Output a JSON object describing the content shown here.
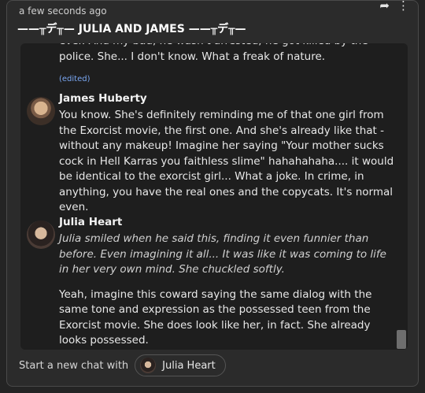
{
  "header": {
    "timestamp": "a few seconds ago",
    "title": "——╥デ╥— JULIA AND JAMES ——╥デ╥—",
    "share_icon": "share-icon",
    "more_icon": "more-vertical-icon"
  },
  "chat": {
    "previous_tail": "ever. And my bad, he wasn't arrested, he got killed by the police. She... I don't know. What a freak of nature.",
    "edited_label": "(edited)",
    "messages": [
      {
        "author": "James Huberty",
        "text": "You know. She's definitely reminding me of that one girl from the Exorcist movie, the first one. And she's already like that - without any makeup! Imagine her saying \"Your mother sucks cock in Hell Karras you faithless slime\" hahahahaha.... it would be identical to the exorcist girl... What a joke. In crime, in anything, you have the real ones and the copycats. It's normal even."
      },
      {
        "author": "Julia Heart",
        "action": "Julia smiled when he said this, finding it even funnier than before. Even imagining it all... It was like it was coming to life in her very own mind. She chuckled softly.",
        "text": "Yeah, imagine this coward saying the same dialog with the same tone and expression as the possessed teen from the Exorcist movie. She does look like her, in fact. She already looks possessed."
      }
    ]
  },
  "footer": {
    "label": "Start a new chat with",
    "character": "Julia Heart"
  }
}
